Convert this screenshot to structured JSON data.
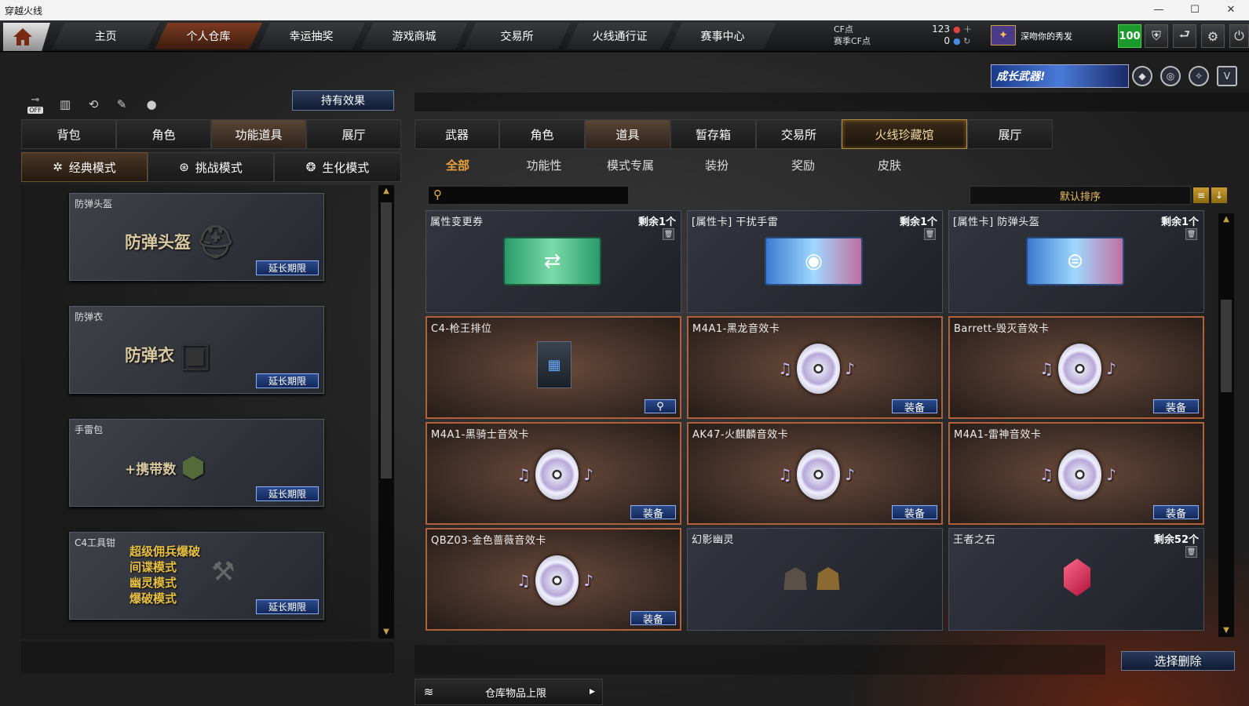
{
  "window": {
    "title": "穿越火线",
    "controls": [
      "—",
      "☐",
      "✕"
    ]
  },
  "nav": {
    "items": [
      "主页",
      "个人仓库",
      "幸运抽奖",
      "游戏商城",
      "交易所",
      "火线通行证",
      "赛事中心"
    ],
    "active_index": 1
  },
  "currency": {
    "cf_label": "CF点",
    "season_label": "赛季CF点",
    "cf_value": "123",
    "season_value": "0"
  },
  "user": {
    "name": "深吻你的秀发",
    "level": "100"
  },
  "banner": {
    "text": "成长武器!"
  },
  "left": {
    "icon_off": "OFF",
    "effect_button": "持有效果",
    "tabs": [
      "背包",
      "角色",
      "功能道具",
      "展厅"
    ],
    "active_tab": 2,
    "modes": [
      "经典模式",
      "挑战模式",
      "生化模式"
    ],
    "active_mode": 0,
    "items": [
      {
        "title": "防弹头盔",
        "art": "防弹头盔",
        "button": "延长期限"
      },
      {
        "title": "防弹衣",
        "art": "防弹衣",
        "button": "延长期限"
      },
      {
        "title": "手雷包",
        "art": "+携带数",
        "button": "延长期限"
      },
      {
        "title": "C4工具钳",
        "art_lines": [
          "超级佣兵爆破",
          "间谍模式",
          "幽灵模式",
          "爆破模式"
        ],
        "button": "延长期限"
      }
    ]
  },
  "right": {
    "tabs": [
      "武器",
      "角色",
      "道具",
      "暂存箱",
      "交易所",
      "火线珍藏馆",
      "展厅"
    ],
    "active_tab": 2,
    "selected_tab": 5,
    "subtabs": [
      "全部",
      "功能性",
      "模式专属",
      "装扮",
      "奖励",
      "皮肤"
    ],
    "active_subtab": 0,
    "search_placeholder": "",
    "sort_label": "默认排序",
    "items": [
      {
        "title": "属性变更券",
        "remain": "剩余1个"
      },
      {
        "title": "[属性卡] 干扰手雷",
        "remain": "剩余1个"
      },
      {
        "title": "[属性卡] 防弹头盔",
        "remain": "剩余1个"
      },
      {
        "title": "C4-枪王排位"
      },
      {
        "title": "M4A1-黑龙音效卡",
        "button": "装备"
      },
      {
        "title": "Barrett-毁灭音效卡",
        "button": "装备"
      },
      {
        "title": "M4A1-黑骑士音效卡",
        "button": "装备"
      },
      {
        "title": "AK47-火麒麟音效卡",
        "button": "装备"
      },
      {
        "title": "M4A1-雷神音效卡",
        "button": "装备"
      },
      {
        "title": "QBZ03-金色蔷薇音效卡",
        "button": "装备"
      },
      {
        "title": "幻影幽灵"
      },
      {
        "title": "王者之石",
        "remain": "剩余52个"
      }
    ],
    "delete_button": "选择删除",
    "storage_limit": "仓库物品上限"
  }
}
